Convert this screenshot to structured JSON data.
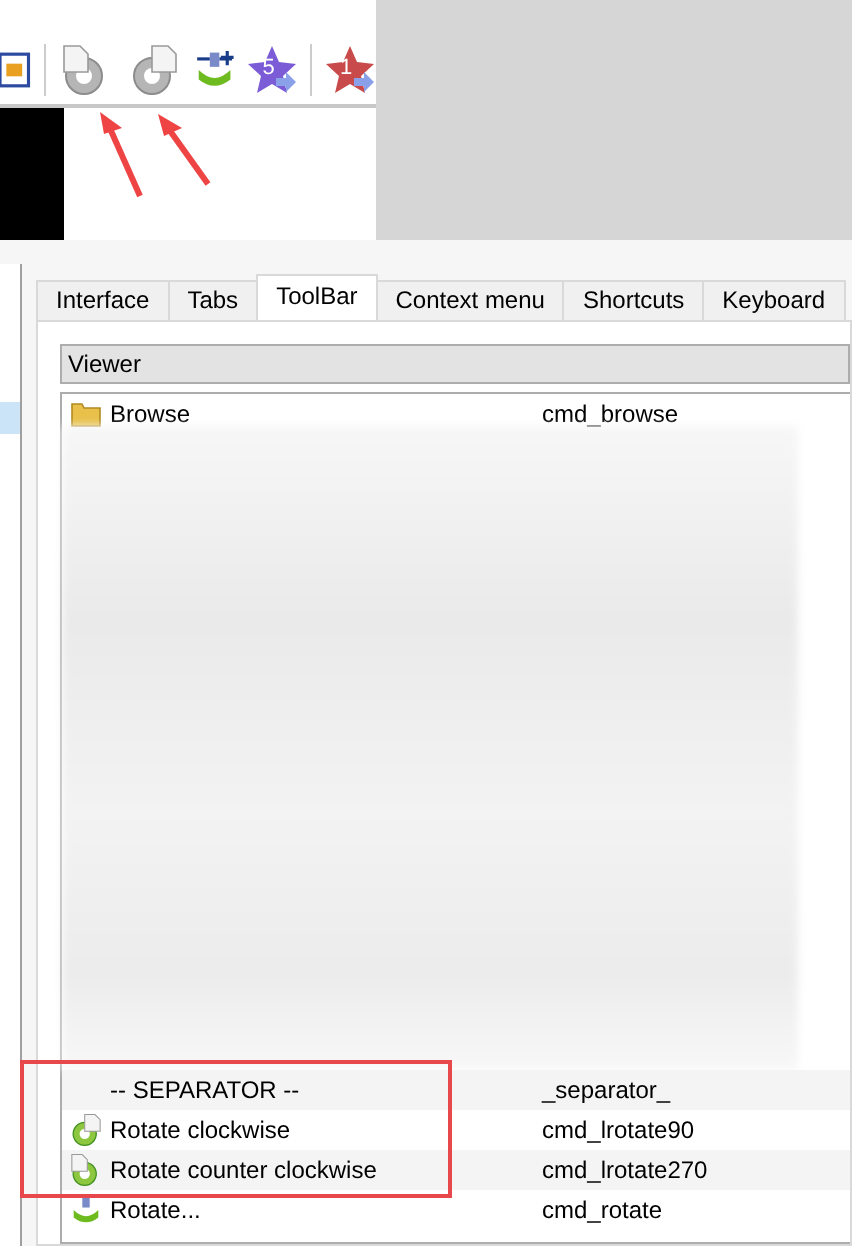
{
  "toolbar": [
    {
      "kind": "fit",
      "disabled": false
    },
    {
      "kind": "rotate_ccw",
      "disabled": true
    },
    {
      "kind": "rotate_cw",
      "disabled": true
    },
    {
      "kind": "adjust",
      "disabled": false
    },
    {
      "kind": "star",
      "badge": "5",
      "color": "#7b5cd6",
      "disabled": false
    },
    {
      "kind": "star",
      "badge": "1",
      "color": "#c94a4a",
      "disabled": false
    }
  ],
  "tabs": [
    {
      "label": "Interface",
      "selected": false
    },
    {
      "label": "Tabs",
      "selected": false
    },
    {
      "label": "ToolBar",
      "selected": true
    },
    {
      "label": "Context menu",
      "selected": false
    },
    {
      "label": "Shortcuts",
      "selected": false
    },
    {
      "label": "Keyboard",
      "selected": false
    }
  ],
  "section": "Viewer",
  "commands_top": [
    {
      "kind": "browse",
      "name": "Browse",
      "command": "cmd_browse"
    }
  ],
  "annotated_commands": [
    {
      "kind": "separator",
      "name": "-- SEPARATOR --",
      "command": "_separator_"
    },
    {
      "kind": "rotate_cw",
      "name": "Rotate clockwise",
      "command": "cmd_lrotate90"
    },
    {
      "kind": "rotate_ccw",
      "name": "Rotate counter clockwise",
      "command": "cmd_lrotate270"
    }
  ],
  "commands_bottom": [
    {
      "kind": "rotate",
      "name": "Rotate...",
      "command": "cmd_rotate"
    }
  ]
}
